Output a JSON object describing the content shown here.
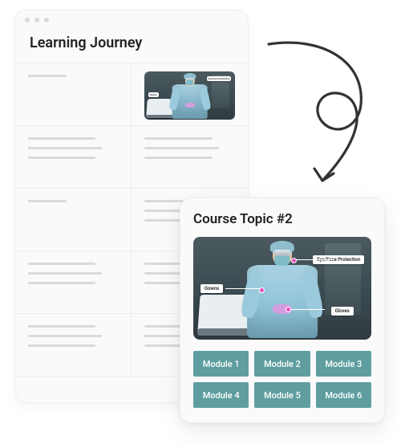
{
  "journey": {
    "title": "Learning Journey"
  },
  "course": {
    "title": "Course Topic #2",
    "modules": [
      {
        "label": "Module 1"
      },
      {
        "label": "Module 2"
      },
      {
        "label": "Module 3"
      },
      {
        "label": "Module 4"
      },
      {
        "label": "Module 5"
      },
      {
        "label": "Module 6"
      }
    ]
  },
  "ppe": {
    "callout_gowns": "Gowns",
    "callout_eye": "Eye/Face Protection",
    "callout_gloves": "Gloves"
  },
  "colors": {
    "module_bg": "#5f9ea0",
    "card_bg": "#fafafa",
    "border": "#eeeeee",
    "placeholder": "#d9d9d9",
    "arrow": "#333333"
  }
}
